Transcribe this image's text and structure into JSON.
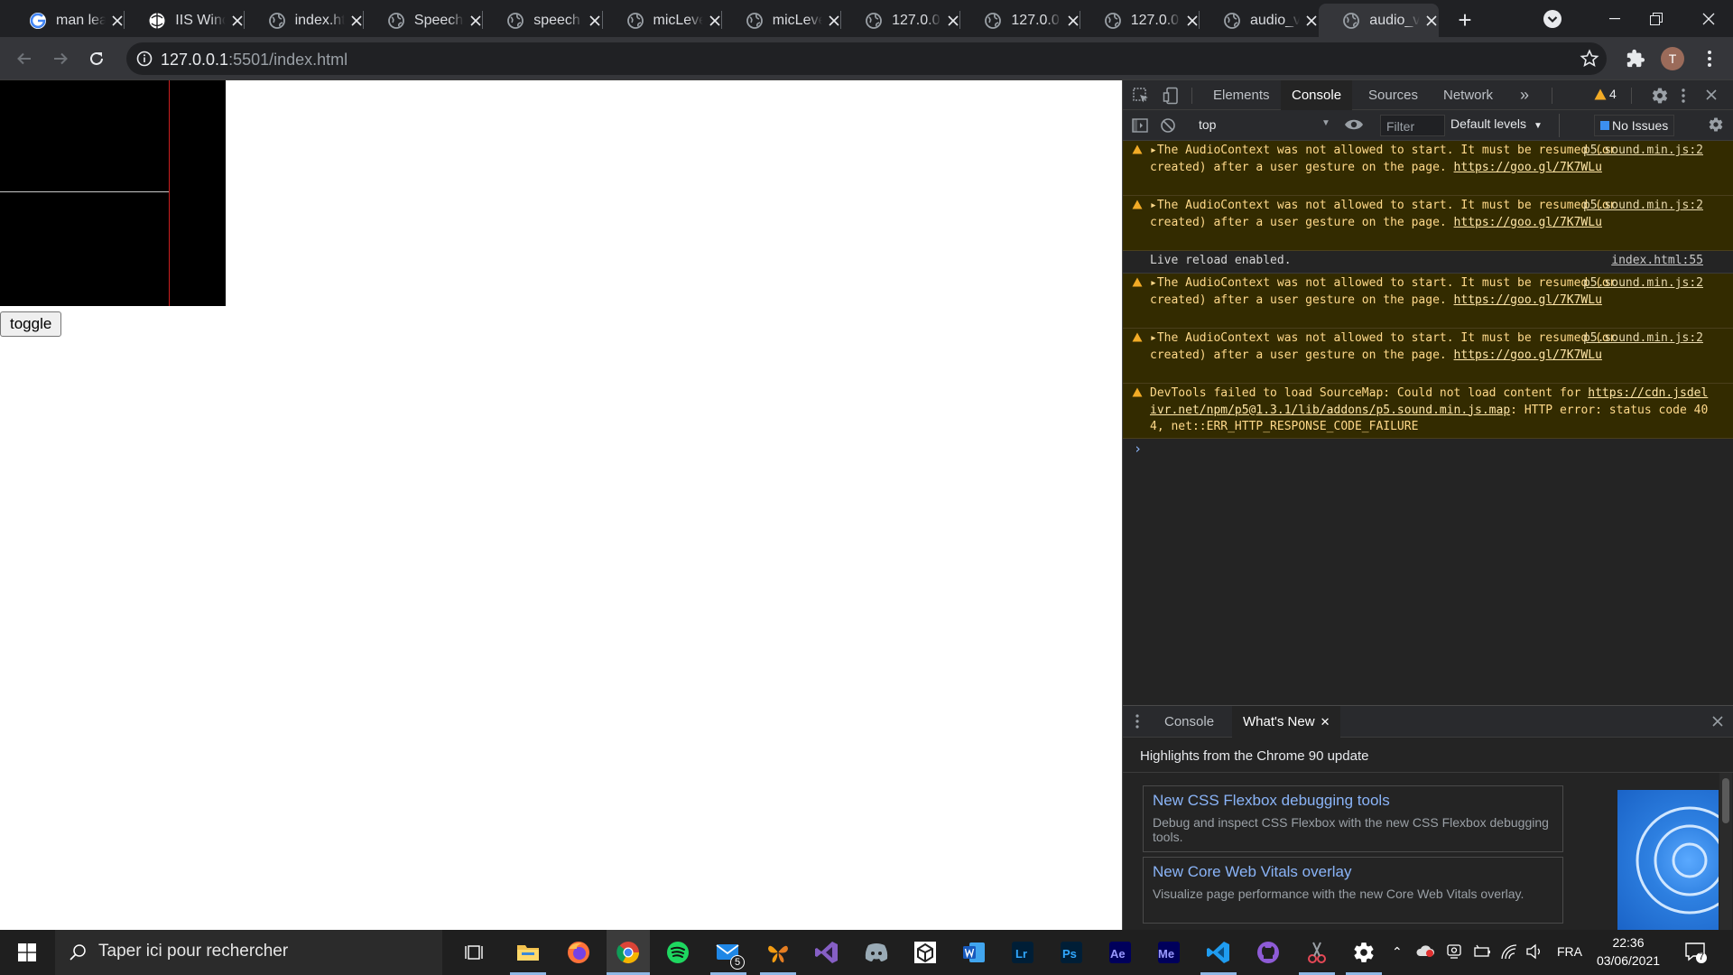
{
  "browser": {
    "tabs": [
      {
        "title": "man lea",
        "favicon": "google-icon"
      },
      {
        "title": "IIS Winc",
        "favicon": "globe-icon"
      },
      {
        "title": "index.ht",
        "favicon": "globe-icon"
      },
      {
        "title": "Speech",
        "favicon": "globe-icon"
      },
      {
        "title": "speech",
        "favicon": "globe-icon"
      },
      {
        "title": "micLeve",
        "favicon": "globe-icon"
      },
      {
        "title": "micLeve",
        "favicon": "globe-icon"
      },
      {
        "title": "127.0.0.",
        "favicon": "globe-icon"
      },
      {
        "title": "127.0.0.",
        "favicon": "globe-icon"
      },
      {
        "title": "127.0.0.",
        "favicon": "globe-icon"
      },
      {
        "title": "audio_v",
        "favicon": "globe-icon"
      },
      {
        "title": "audio_v",
        "favicon": "globe-icon"
      }
    ],
    "address": {
      "host": "127.0.0.1",
      "rest": ":5501/index.html"
    },
    "profile_initial": "T"
  },
  "page": {
    "toggle_label": "toggle"
  },
  "devtools": {
    "tabs": [
      "Elements",
      "Console",
      "Sources",
      "Network"
    ],
    "more": "»",
    "warning_count": "4",
    "context": "top",
    "filter_placeholder": "Filter",
    "levels": "Default levels",
    "issues": "No Issues",
    "messages": [
      {
        "type": "warn",
        "text": "The AudioContext was not allowed to start. It must be resumed (or created) after a user gesture on the page. ",
        "link": "https://goo.gl/7K7WLu",
        "source": "p5.sound.min.js:2"
      },
      {
        "type": "warn",
        "text": "The AudioContext was not allowed to start. It must be resumed (or created) after a user gesture on the page. ",
        "link": "https://goo.gl/7K7WLu",
        "source": "p5.sound.min.js:2"
      },
      {
        "type": "info",
        "text": "Live reload enabled.",
        "link": "",
        "source": "index.html:55"
      },
      {
        "type": "warn",
        "text": "The AudioContext was not allowed to start. It must be resumed (or created) after a user gesture on the page. ",
        "link": "https://goo.gl/7K7WLu",
        "source": "p5.sound.min.js:2"
      },
      {
        "type": "warn",
        "text": "The AudioContext was not allowed to start. It must be resumed (or created) after a user gesture on the page. ",
        "link": "https://goo.gl/7K7WLu",
        "source": "p5.sound.min.js:2"
      },
      {
        "type": "warn",
        "text": "DevTools failed to load SourceMap: Could not load content for ",
        "link": "https://cdn.jsdelivr.net/npm/p5@1.3.1/lib/addons/p5.sound.min.js.map",
        "after": ": HTTP error: status code 404, net::ERR_HTTP_RESPONSE_CODE_FAILURE",
        "source": ""
      }
    ],
    "prompt": "›",
    "drawer": {
      "tabs": [
        "Console",
        "What's New"
      ],
      "heading": "Highlights from the Chrome 90 update",
      "cards": [
        {
          "title": "New CSS Flexbox debugging tools",
          "desc": "Debug and inspect CSS Flexbox with the new CSS Flexbox debugging tools."
        },
        {
          "title": "New Core Web Vitals overlay",
          "desc": "Visualize page performance with the new Core Web Vitals overlay."
        }
      ]
    }
  },
  "taskbar": {
    "search_placeholder": "Taper ici pour rechercher",
    "language": "FRA",
    "time": "22:36",
    "date": "03/06/2021",
    "mail_badge": "5",
    "notification_count": "7",
    "apps": [
      "task-view-icon",
      "file-explorer-icon",
      "firefox-icon",
      "chrome-icon",
      "spotify-icon",
      "mail-icon",
      "butterfly-icon",
      "visual-studio-icon",
      "discord-icon",
      "unity-icon",
      "word-icon",
      "lightroom-icon",
      "photoshop-icon",
      "after-effects-icon",
      "media-encoder-icon",
      "vscode-icon",
      "github-desktop-icon",
      "snipping-icon",
      "settings-icon"
    ]
  }
}
